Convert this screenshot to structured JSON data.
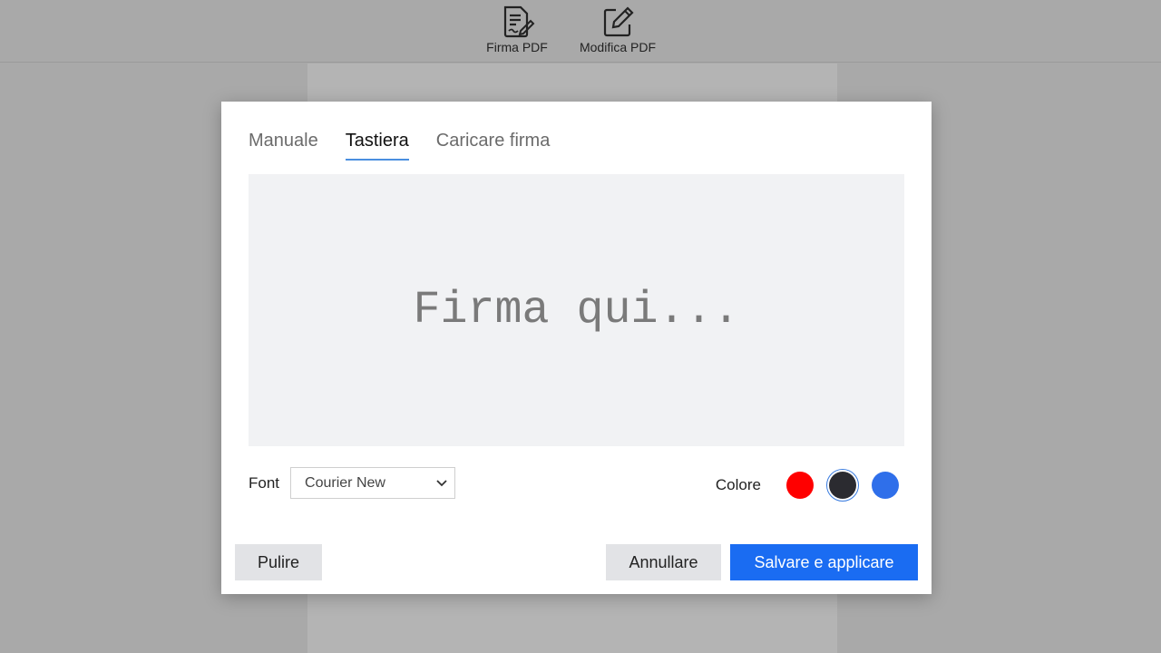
{
  "toolbar": {
    "items": [
      {
        "label": "Firma PDF",
        "icon": "sign-document-icon"
      },
      {
        "label": "Modifica PDF",
        "icon": "edit-pencil-icon"
      }
    ]
  },
  "modal": {
    "tabs": [
      {
        "label": "Manuale",
        "active": false
      },
      {
        "label": "Tastiera",
        "active": true
      },
      {
        "label": "Caricare firma",
        "active": false
      }
    ],
    "signature": {
      "placeholder": "Firma qui...",
      "value": ""
    },
    "font": {
      "label": "Font",
      "selected": "Courier New"
    },
    "color": {
      "label": "Colore",
      "options": [
        "#ff0000",
        "#2b2b30",
        "#2f6fea"
      ],
      "selected": "#2b2b30"
    },
    "buttons": {
      "clear": "Pulire",
      "cancel": "Annullare",
      "save": "Salvare e applicare"
    }
  }
}
